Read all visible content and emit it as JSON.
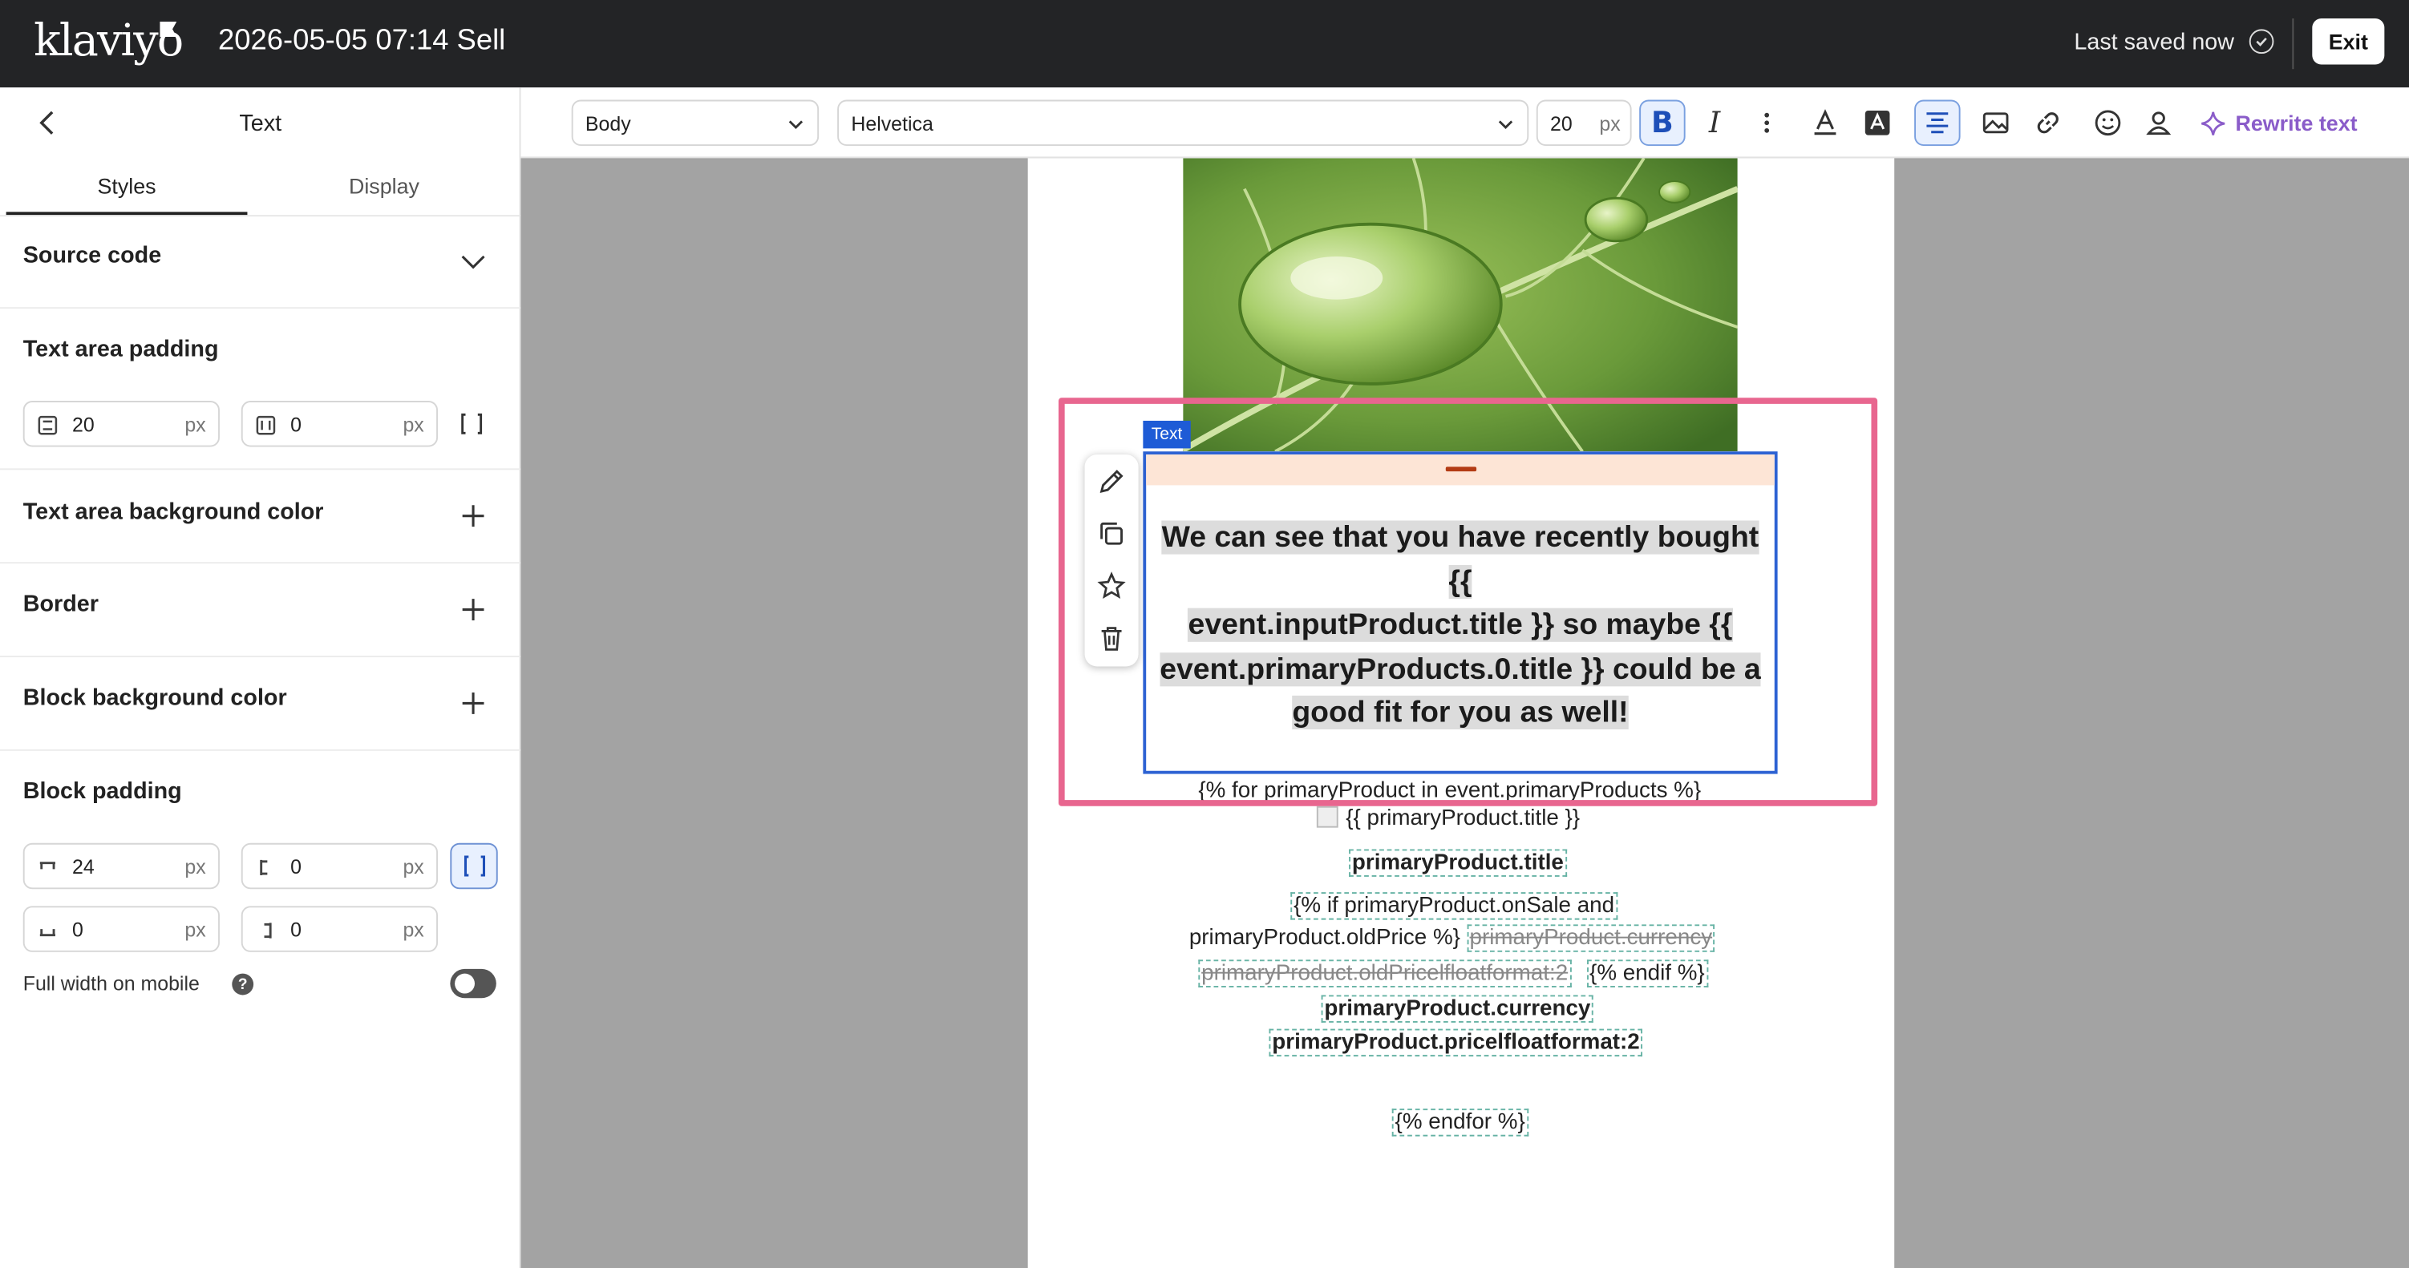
{
  "app": {
    "logo": "klaviyo",
    "campaign_title": "2026-05-05 07:14 Sell",
    "save_status": "Last saved now",
    "exit_label": "Exit"
  },
  "panel": {
    "title": "Text",
    "tabs": [
      "Styles",
      "Display"
    ],
    "source_code": "Source code",
    "text_area_padding": {
      "label": "Text area padding",
      "vertical": "20",
      "horizontal": "0",
      "unit": "px"
    },
    "text_area_bg": "Text area background color",
    "border": "Border",
    "block_bg": "Block background color",
    "block_padding": {
      "label": "Block padding",
      "top": "24",
      "left": "0",
      "bottom": "0",
      "right": "0",
      "unit": "px"
    },
    "full_width_mobile": "Full width on mobile",
    "help": "?"
  },
  "toolbar": {
    "style": "Body",
    "font": "Helvetica",
    "size": "20",
    "size_unit": "px",
    "bold": "B",
    "italic": "I",
    "rewrite": "Rewrite text"
  },
  "canvas": {
    "block_tag": "Text",
    "main_lines": [
      "We can see that you have recently bought {{",
      "event.inputProduct.title }} so maybe {{",
      "event.primaryProducts.0.title }} could be a",
      "good fit for you as well!"
    ],
    "for_loop": "{% for primaryProduct in event.primaryProducts %}",
    "img_alt": "{{ primaryProduct.title }}",
    "product_title": "primaryProduct.title",
    "if_line1": "{% if primaryProduct.onSale and",
    "if_line2": "primaryProduct.oldPrice %}",
    "old_currency": "primaryProduct.currency",
    "old_price": "primaryProduct.oldPricelfloatformat:2",
    "endif": "{% endif %}",
    "currency": "primaryProduct.currency",
    "price": "primaryProduct.pricelfloatformat:2",
    "endfor": "{% endfor %}"
  },
  "colors": {
    "topbar": "#232426",
    "selection": "#e8668f",
    "block_outline": "#2d62d3",
    "accent_ai": "#8a5cc9",
    "canvas_bg": "#a3a3a3"
  }
}
